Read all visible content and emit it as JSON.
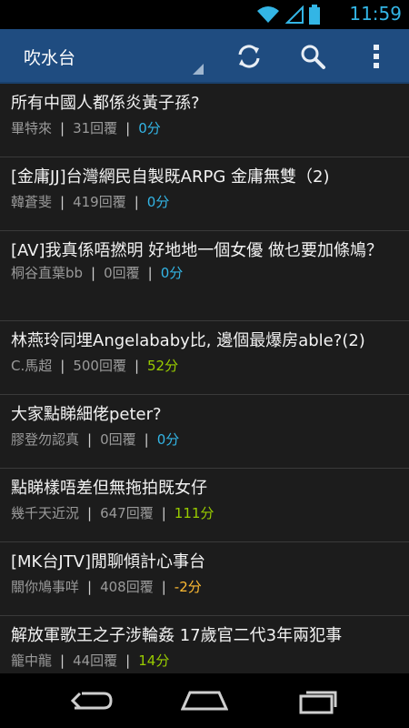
{
  "status": {
    "time": "11:59"
  },
  "toolbar": {
    "title": "吹水台"
  },
  "posts": [
    {
      "title": "所有中國人都係炎黃子孫?",
      "author": "畢特來",
      "replies": "31回覆",
      "score": "0分",
      "score_color": "#33b5e5"
    },
    {
      "title": "[金庸JJ]台灣網民自製既ARPG 金庸無雙（2)",
      "author": "韓蒼斐",
      "replies": "419回覆",
      "score": "0分",
      "score_color": "#33b5e5"
    },
    {
      "title": "[AV]我真係唔撚明 好地地一個女優 做乜要加條鳩？",
      "author": "桐谷直葉bb",
      "replies": "0回覆",
      "score": "0分",
      "score_color": "#33b5e5"
    },
    {
      "title": "林燕玲同埋Angelababy比, 邊個最爆房able?(2)",
      "author": "C.馬超",
      "replies": "500回覆",
      "score": "52分",
      "score_color": "#99cc00"
    },
    {
      "title": "大家點睇細佬peter?",
      "author": "膠登勿認真",
      "replies": "0回覆",
      "score": "0分",
      "score_color": "#33b5e5"
    },
    {
      "title": "點睇樣唔差但無拖拍既女仔",
      "author": "幾千天近況",
      "replies": "647回覆",
      "score": "111分",
      "score_color": "#99cc00"
    },
    {
      "title": "[MK台JTV]閒聊傾計心事台",
      "author": "關你鳩事咩",
      "replies": "408回覆",
      "score": "-2分",
      "score_color": "#ffbb33"
    },
    {
      "title": "解放軍歌王之子涉輪姦 17歲官二代3年兩犯事",
      "author": "籠中龍",
      "replies": "44回覆",
      "score": "14分",
      "score_color": "#99cc00"
    }
  ]
}
